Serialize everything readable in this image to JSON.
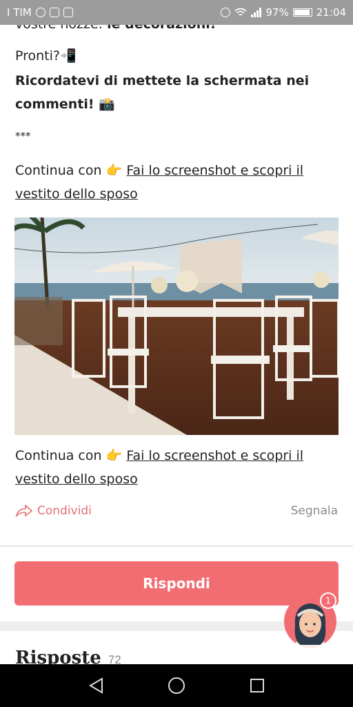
{
  "status_bar": {
    "carrier": "I TIM",
    "battery": "97%",
    "time": "21:04"
  },
  "post": {
    "cut_line_prefix": "vostre nozze: ",
    "cut_line_bold": "le decorazioni!",
    "ready": "Pronti?",
    "ready_emoji": "📲",
    "reminder": "Ricordatevi di mettete la schermata nei commenti!",
    "reminder_emoji": "📸",
    "divider": "***",
    "continue_prefix": "Continua con",
    "continue_emoji": "👉",
    "continue_link": "Fai lo screenshot e scopri il vestito dello sposo"
  },
  "actions": {
    "share_label": "Condividi",
    "report_label": "Segnala"
  },
  "reply_button": "Rispondi",
  "answers": {
    "title": "Risposte",
    "count": "72"
  },
  "avatar_badge": "1",
  "icons": {
    "share": "share-arrow-icon",
    "back": "back-icon",
    "home": "home-icon",
    "recents": "recents-icon"
  },
  "colors": {
    "accent": "#f26d72",
    "status_bar": "#9c9c9c",
    "nav_bar": "#000000"
  }
}
